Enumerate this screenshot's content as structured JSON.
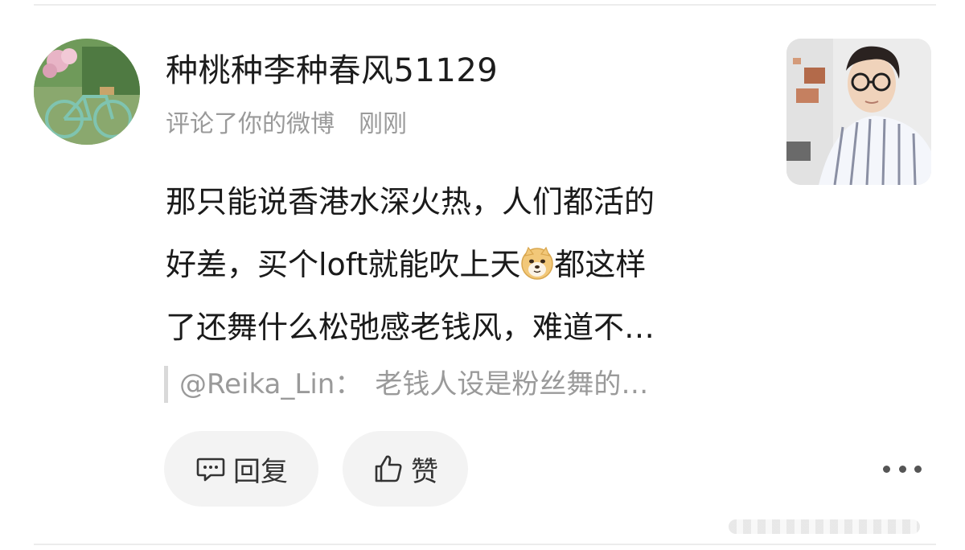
{
  "comment": {
    "username": "种桃种李种春风51129",
    "action": "评论了你的微博",
    "time": "刚刚",
    "text_lines": [
      "那只能说香港水深火热，人们都活的",
      "好差，买个loft就能吹上天",
      "都这样",
      "了还舞什么松弛感老钱风，难道不…"
    ],
    "emoji": "doge-emoji",
    "quote": {
      "author": "@Reika_Lin：",
      "text": "老钱人设是粉丝舞的…"
    }
  },
  "actions": {
    "reply_label": "回复",
    "like_label": "赞",
    "reply_icon": "comment-icon",
    "like_icon": "thumbs-up-icon",
    "more_icon": "more-icon"
  },
  "colors": {
    "text_primary": "#1a1a1a",
    "text_secondary": "#9a9a9a",
    "pill_bg": "#f3f3f3",
    "divider": "#ececec"
  }
}
